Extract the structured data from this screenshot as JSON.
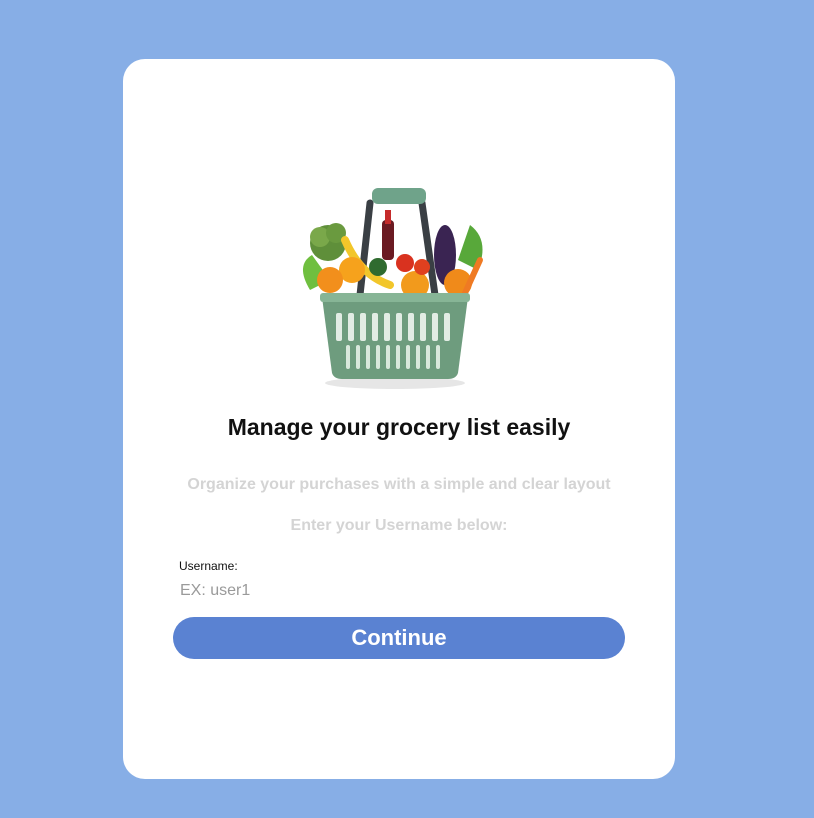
{
  "hero": {
    "icon": "grocery-basket-icon"
  },
  "header": {
    "title": "Manage your grocery list easily"
  },
  "intro": {
    "subtitle": "Organize your purchases with a simple and clear layout",
    "instruction": "Enter your Username below:"
  },
  "form": {
    "username_label": "Username:",
    "username_value": "",
    "username_placeholder": "EX: user1",
    "continue_label": "Continue"
  },
  "colors": {
    "background": "#87aee6",
    "card": "#ffffff",
    "button": "#5a82d2",
    "muted_text": "#d4d4d4"
  }
}
